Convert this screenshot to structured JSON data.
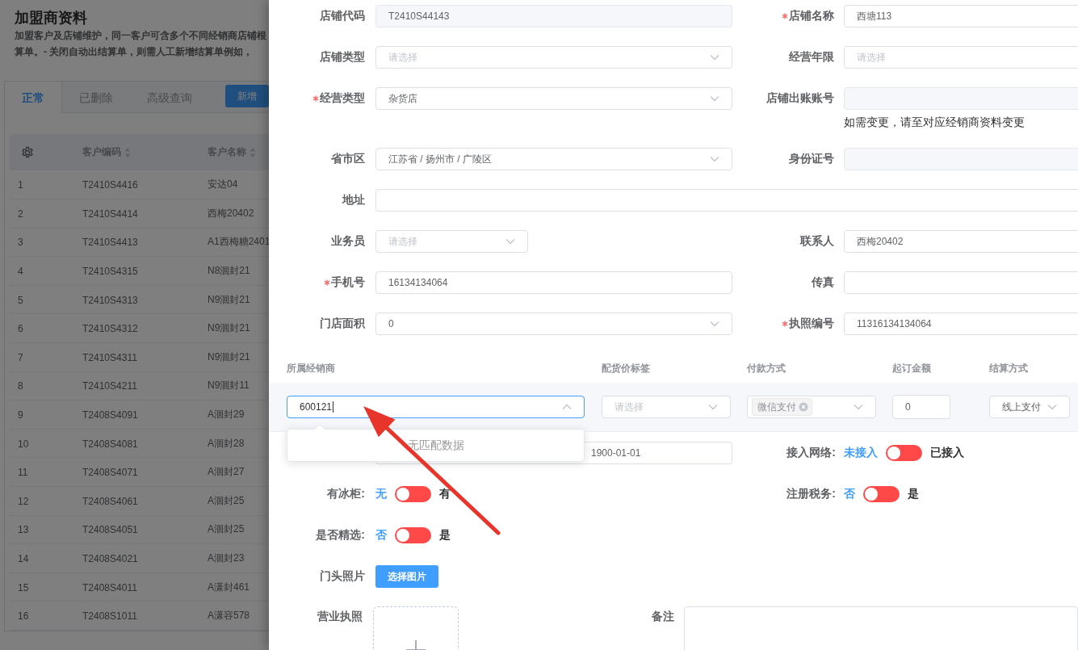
{
  "page": {
    "title": "加盟商资料",
    "description_lines": [
      "加盟客户及店铺维护，同一客户可含多个不同经销商店铺根",
      "算单。- 关闭自动出结算单，则需人工新增结算单例如，"
    ],
    "tabs": [
      {
        "label": "正常",
        "selected": true
      },
      {
        "label": "已删除",
        "selected": false
      },
      {
        "label": "高级查询",
        "selected": false
      }
    ],
    "add_button": "新增",
    "table": {
      "columns": [
        "客户编码",
        "客户名称"
      ],
      "rows": [
        {
          "index": "1",
          "code": "T2410S4416",
          "name": "安达04"
        },
        {
          "index": "2",
          "code": "T2410S4414",
          "name": "西梅20402"
        },
        {
          "index": "3",
          "code": "T2410S4413",
          "name": "A1西梅糖2401"
        },
        {
          "index": "4",
          "code": "T2410S4315",
          "name": "N8洄封21"
        },
        {
          "index": "5",
          "code": "T2410S4313",
          "name": "N9洄封21"
        },
        {
          "index": "6",
          "code": "T2410S4312",
          "name": "N9洄封21"
        },
        {
          "index": "7",
          "code": "T2410S4311",
          "name": "N9洄封21"
        },
        {
          "index": "8",
          "code": "T2410S4211",
          "name": "N9洄封11"
        },
        {
          "index": "9",
          "code": "T2408S4091",
          "name": "A洄封29"
        },
        {
          "index": "10",
          "code": "T2408S4081",
          "name": "A洄封28"
        },
        {
          "index": "11",
          "code": "T2408S4071",
          "name": "A洄封27"
        },
        {
          "index": "12",
          "code": "T2408S4061",
          "name": "A洄封25"
        },
        {
          "index": "13",
          "code": "T2408S4051",
          "name": "A洄封25"
        },
        {
          "index": "14",
          "code": "T2408S4021",
          "name": "A洄封23"
        },
        {
          "index": "15",
          "code": "T2408S4011",
          "name": "A潇封461"
        },
        {
          "index": "16",
          "code": "T2408S1011",
          "name": "A潇容578"
        }
      ]
    }
  },
  "drawer": {
    "form_rows": [
      {
        "fields": [
          {
            "label": "店铺代码",
            "required": false,
            "kind": "disabled",
            "value": "T2410S44143"
          },
          {
            "label": "店铺名称",
            "required": true,
            "kind": "input",
            "value": "西塘113"
          }
        ]
      },
      {
        "fields": [
          {
            "label": "店铺类型",
            "required": false,
            "kind": "select",
            "placeholder": "请选择"
          },
          {
            "label": "经营年限",
            "required": false,
            "kind": "input",
            "placeholder": "请选择"
          }
        ]
      },
      {
        "fields": [
          {
            "label": "经营类型",
            "required": true,
            "kind": "select",
            "value": "杂货店"
          },
          {
            "label": "店铺出账账号",
            "required": false,
            "kind": "disabled",
            "hint": "如需变更，请至对应经销商资料变更"
          }
        ]
      },
      {
        "fields": [
          {
            "label": "省市区",
            "required": false,
            "kind": "select",
            "value": "江苏省 / 扬州市 / 广陵区"
          },
          {
            "label": "身份证号",
            "required": false,
            "kind": "disabled"
          }
        ]
      },
      {
        "fields": [
          {
            "label": "地址",
            "required": false,
            "kind": "full-input"
          }
        ]
      },
      {
        "fields": [
          {
            "label": "业务员",
            "required": false,
            "kind": "short-select",
            "placeholder": "请选择"
          },
          {
            "label": "联系人",
            "required": false,
            "kind": "input",
            "value": "西梅20402"
          }
        ]
      },
      {
        "fields": [
          {
            "label": "手机号",
            "required": true,
            "kind": "input",
            "value": "16134134064"
          },
          {
            "label": "传真",
            "required": false,
            "kind": "input"
          }
        ]
      },
      {
        "fields": [
          {
            "label": "门店面积",
            "required": false,
            "kind": "select",
            "value": "0"
          },
          {
            "label": "执照编号",
            "required": true,
            "kind": "input",
            "value": "11316134134064"
          }
        ]
      }
    ],
    "dealer_table": {
      "columns": [
        "所属经销商",
        "配货价标签",
        "付款方式",
        "起订金额",
        "结算方式"
      ],
      "dealer": {
        "value": "600121",
        "focused": true
      },
      "price_tag": {
        "placeholder": "请选择"
      },
      "payment": {
        "tags": [
          "微信支付"
        ]
      },
      "min_amount": "0",
      "settlement": "线上支付",
      "dropdown": {
        "empty_text": "无匹配数据"
      }
    },
    "date_field": {
      "value": "1900-01-01"
    },
    "switches": [
      {
        "label": "接入网络:",
        "off_text": "未接入",
        "on_text": "已接入",
        "on": false
      },
      {
        "label": "有冰柜:",
        "off_text": "无",
        "on_text": "有",
        "on": false
      },
      {
        "label": "注册税务:",
        "off_text": "否",
        "on_text": "是",
        "on": false
      },
      {
        "label": "是否精选:",
        "off_text": "否",
        "on_text": "是",
        "on": false
      }
    ],
    "photo": {
      "label": "门头照片",
      "button": "选择图片"
    },
    "license": {
      "label": "营业执照"
    },
    "remarks": {
      "label": "备注"
    }
  }
}
